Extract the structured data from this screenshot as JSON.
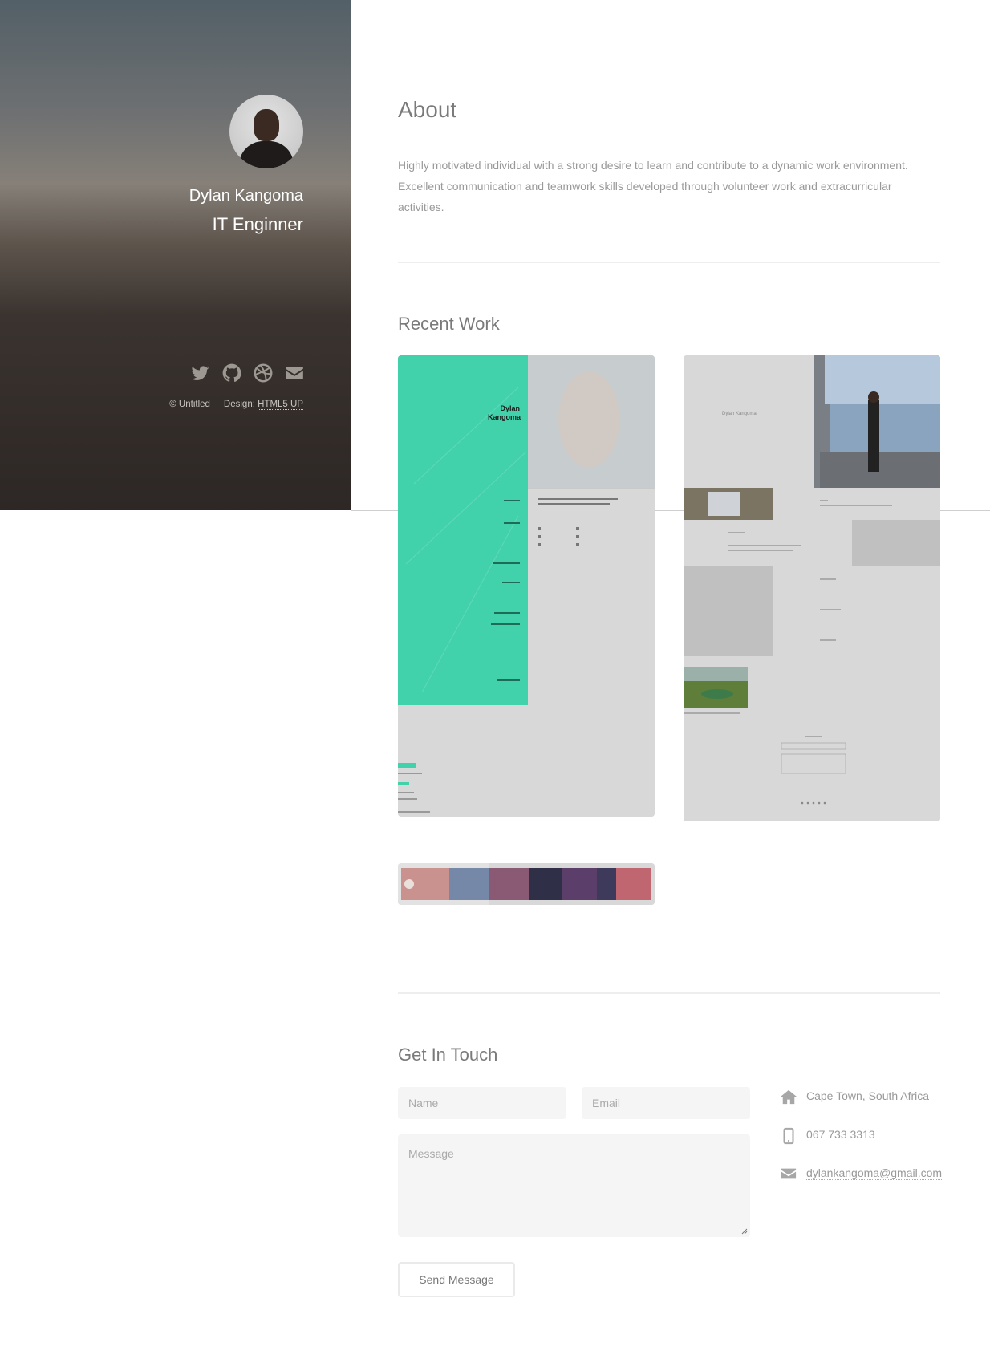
{
  "profile": {
    "name": "Dylan Kangoma",
    "title": "IT Enginner"
  },
  "social_icons": [
    "twitter-icon",
    "github-icon",
    "dribbble-icon",
    "envelope-icon"
  ],
  "footer": {
    "copyright": "© Untitled",
    "design_label": "Design:",
    "design_link": "HTML5 UP"
  },
  "about": {
    "title": "About",
    "text": "Highly motivated individual with a strong desire to learn and contribute to a dynamic work environment. Excellent communication and teamwork skills developed through volunteer work and extracurricular activities."
  },
  "recent_work": {
    "title": "Recent Work",
    "card1_heading": "Dylan Kangoma",
    "card2_heading": "Dylan Kangoma"
  },
  "contact": {
    "title": "Get In Touch",
    "name_placeholder": "Name",
    "email_placeholder": "Email",
    "message_placeholder": "Message",
    "send_label": "Send Message",
    "address": "Cape Town, South Africa",
    "phone": "067 733 3313",
    "email": "dylankangoma@gmail.com"
  },
  "colors": {
    "accent": "#42d2ab",
    "sidebar_top": "#536067",
    "sidebar_bottom": "#2d2725"
  }
}
